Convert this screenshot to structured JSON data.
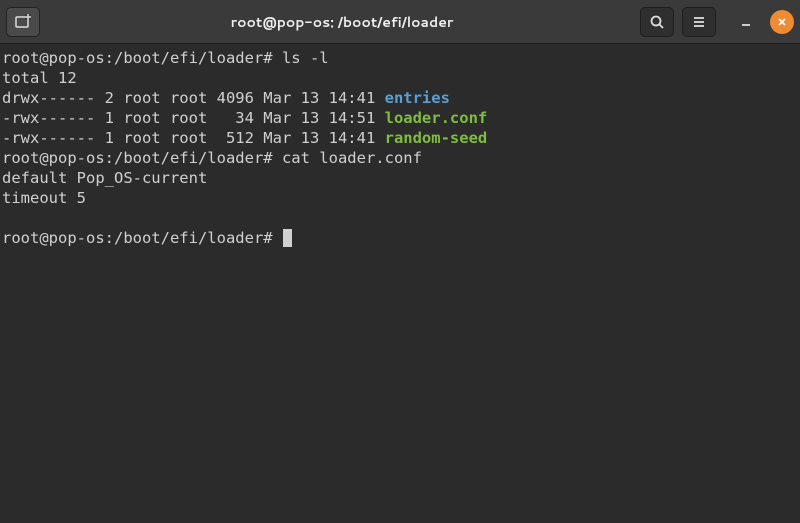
{
  "window": {
    "title": "root@pop-os: /boot/efi/loader"
  },
  "terminal": {
    "prompt": "root@pop-os:/boot/efi/loader#",
    "cmd1": "ls -l",
    "total_line": "total 12",
    "rows": [
      {
        "perms": "drwx------ 2 root root 4096 Mar 13 14:41 ",
        "name": "entries",
        "type": "dir"
      },
      {
        "perms": "-rwx------ 1 root root   34 Mar 13 14:51 ",
        "name": "loader.conf",
        "type": "file"
      },
      {
        "perms": "-rwx------ 1 root root  512 Mar 13 14:41 ",
        "name": "random-seed",
        "type": "file"
      }
    ],
    "cmd2": "cat loader.conf",
    "cat_output": [
      "default Pop_OS-current",
      "timeout 5"
    ]
  }
}
